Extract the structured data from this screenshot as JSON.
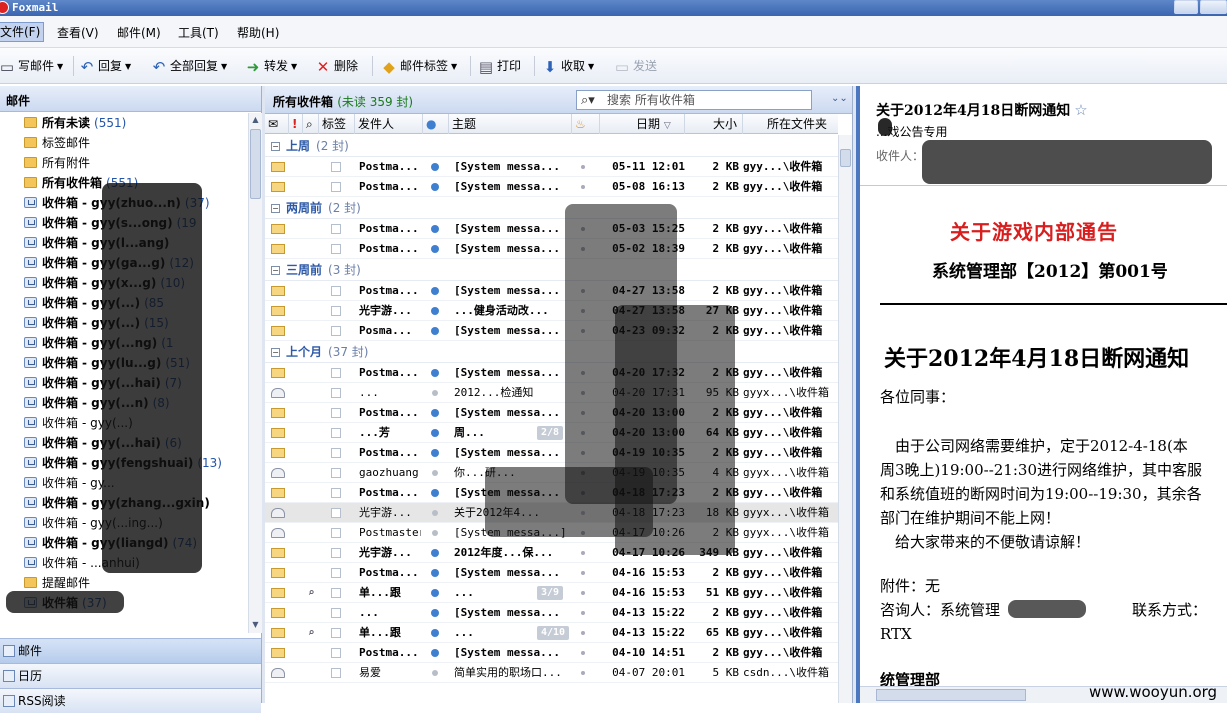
{
  "app": {
    "title": "Foxmail"
  },
  "menu": [
    "文件(F)",
    "查看(V)",
    "邮件(M)",
    "工具(T)",
    "帮助(H)"
  ],
  "toolbar": {
    "compose": "写邮件",
    "reply": "回复",
    "reply_all": "全部回复",
    "forward": "转发",
    "delete": "删除",
    "tag": "邮件标签",
    "print": "打印",
    "receive": "收取",
    "send": "发送"
  },
  "left": {
    "header": "邮件",
    "folders": [
      {
        "label": "所有未读",
        "count": "(551)",
        "bold": true,
        "type": "folder"
      },
      {
        "label": "标签邮件",
        "count": "",
        "bold": false,
        "type": "folder"
      },
      {
        "label": "所有附件",
        "count": "",
        "bold": false,
        "type": "folder"
      },
      {
        "label": "所有收件箱",
        "count": "(551)",
        "bold": true,
        "type": "folder"
      },
      {
        "label": "收件箱",
        "count": "(37)",
        "bold": true,
        "type": "inbox",
        "suffix": "- gyy(zhuo...n)"
      },
      {
        "label": "收件箱",
        "count": "(19",
        "bold": true,
        "type": "inbox",
        "suffix": "- gyy(s...ong)"
      },
      {
        "label": "收件箱",
        "count": "",
        "bold": true,
        "type": "inbox",
        "suffix": "- gyy(l...ang)"
      },
      {
        "label": "收件箱",
        "count": "(12)",
        "bold": true,
        "type": "inbox",
        "suffix": "- gyy(ga...g)"
      },
      {
        "label": "收件箱",
        "count": "(10)",
        "bold": true,
        "type": "inbox",
        "suffix": "- gyy(x...g)"
      },
      {
        "label": "收件箱",
        "count": "(85",
        "bold": true,
        "type": "inbox",
        "suffix": "- gyy(...)"
      },
      {
        "label": "收件箱",
        "count": "(15)",
        "bold": true,
        "type": "inbox",
        "suffix": "- gyy(...)"
      },
      {
        "label": "收件箱",
        "count": "(1",
        "bold": true,
        "type": "inbox",
        "suffix": "- gyy(...ng)"
      },
      {
        "label": "收件箱",
        "count": "(51)",
        "bold": true,
        "type": "inbox",
        "suffix": "- gyy(lu...g)"
      },
      {
        "label": "收件箱",
        "count": "(7)",
        "bold": true,
        "type": "inbox",
        "suffix": "- gyy(...hai)"
      },
      {
        "label": "收件箱",
        "count": "(8)",
        "bold": true,
        "type": "inbox",
        "suffix": "- gyy(...n)"
      },
      {
        "label": "收件箱",
        "count": "",
        "bold": false,
        "type": "inbox",
        "suffix": "- gyy(...)"
      },
      {
        "label": "收件箱",
        "count": "(6)",
        "bold": true,
        "type": "inbox",
        "suffix": "- gyy(...hai)"
      },
      {
        "label": "收件箱",
        "count": "(13)",
        "bold": true,
        "type": "inbox",
        "suffix": "- gyy(fengshuai)"
      },
      {
        "label": "收件箱",
        "count": "",
        "bold": false,
        "type": "inbox",
        "suffix": "- gy..."
      },
      {
        "label": "收件箱",
        "count": "",
        "bold": true,
        "type": "inbox",
        "suffix": "- gyy(zhang...gxin)"
      },
      {
        "label": "收件箱",
        "count": "",
        "bold": false,
        "type": "inbox",
        "suffix": "- gyy(...ing...)"
      },
      {
        "label": "收件箱",
        "count": "(74)",
        "bold": true,
        "type": "inbox",
        "suffix": "- gyy(liangd)"
      },
      {
        "label": "收件箱",
        "count": "",
        "bold": false,
        "type": "inbox",
        "suffix": "- ...anhui)"
      },
      {
        "label": "提醒邮件",
        "count": "",
        "bold": false,
        "type": "folder"
      },
      {
        "label": "收件箱",
        "count": "(37)",
        "bold": true,
        "type": "inbox",
        "suffix": ""
      }
    ],
    "nav": [
      "邮件",
      "日历",
      "RSS阅读"
    ]
  },
  "middle": {
    "title": "所有收件箱",
    "unread": "(未读 359 封)",
    "search_placeholder": "搜索 所有收件箱",
    "columns": {
      "tag": "标签",
      "sender": "发件人",
      "subject": "主题",
      "date": "日期",
      "size": "大小",
      "folder": "所在文件夹"
    },
    "groups": [
      {
        "name": "上周",
        "count": "(2 封)",
        "rows": [
          {
            "sender": "Postma...",
            "subject": "[System messa...",
            "date": "05-11 12:01",
            "size": "2 KB",
            "folder": "gyy...\\收件箱",
            "unread": true,
            "read_icon": false,
            "clip": false,
            "page": ""
          },
          {
            "sender": "Postma...",
            "subject": "[System messa...",
            "date": "05-08 16:13",
            "size": "2 KB",
            "folder": "gyy...\\收件箱",
            "unread": true,
            "read_icon": false,
            "clip": false,
            "page": ""
          }
        ]
      },
      {
        "name": "两周前",
        "count": "(2 封)",
        "rows": [
          {
            "sender": "Postma...",
            "subject": "[System messa...",
            "date": "05-03 15:25",
            "size": "2 KB",
            "folder": "gyy...\\收件箱",
            "unread": true,
            "read_icon": false,
            "clip": false,
            "page": ""
          },
          {
            "sender": "Postma...",
            "subject": "[System messa...",
            "date": "05-02 18:39",
            "size": "2 KB",
            "folder": "gyy...\\收件箱",
            "unread": true,
            "read_icon": false,
            "clip": false,
            "page": ""
          }
        ]
      },
      {
        "name": "三周前",
        "count": "(3 封)",
        "rows": [
          {
            "sender": "Postma...",
            "subject": "[System messa...",
            "date": "04-27 13:58",
            "size": "2 KB",
            "folder": "gyy...\\收件箱",
            "unread": true,
            "read_icon": false,
            "clip": false,
            "page": ""
          },
          {
            "sender": "光宇游...",
            "subject": "...健身活动改...",
            "date": "04-27 13:58",
            "size": "27 KB",
            "folder": "gyy...\\收件箱",
            "unread": true,
            "read_icon": false,
            "clip": false,
            "page": ""
          },
          {
            "sender": "Posma...",
            "subject": "[System messa...",
            "date": "04-23 09:32",
            "size": "2 KB",
            "folder": "gyy...\\收件箱",
            "unread": true,
            "read_icon": false,
            "clip": false,
            "page": ""
          }
        ]
      },
      {
        "name": "上个月",
        "count": "(37 封)",
        "rows": [
          {
            "sender": "Postma...",
            "subject": "[System messa...",
            "date": "04-20 17:32",
            "size": "2 KB",
            "folder": "gyy...\\收件箱",
            "unread": true,
            "read_icon": false,
            "clip": false,
            "page": ""
          },
          {
            "sender": "...",
            "subject": "2012...检通知",
            "date": "04-20 17:31",
            "size": "95 KB",
            "folder": "gyyx...\\收件箱",
            "unread": false,
            "read_icon": true,
            "clip": false,
            "page": ""
          },
          {
            "sender": "Postma...",
            "subject": "[System messa...",
            "date": "04-20 13:00",
            "size": "2 KB",
            "folder": "gyy...\\收件箱",
            "unread": true,
            "read_icon": false,
            "clip": false,
            "page": ""
          },
          {
            "sender": "...芳",
            "subject": "周...",
            "date": "04-20 13:00",
            "size": "64 KB",
            "folder": "gyy...\\收件箱",
            "unread": true,
            "read_icon": false,
            "clip": false,
            "page": "2/8"
          },
          {
            "sender": "Postma...",
            "subject": "[System messa...",
            "date": "04-19 10:35",
            "size": "2 KB",
            "folder": "gyy...\\收件箱",
            "unread": true,
            "read_icon": false,
            "clip": false,
            "page": ""
          },
          {
            "sender": "gaozhuang",
            "subject": "你...研...",
            "date": "04-19 10:35",
            "size": "4 KB",
            "folder": "gyyx...\\收件箱",
            "unread": false,
            "read_icon": true,
            "clip": false,
            "page": ""
          },
          {
            "sender": "Postma...",
            "subject": "[System messa...",
            "date": "04-18 17:23",
            "size": "2 KB",
            "folder": "gyy...\\收件箱",
            "unread": true,
            "read_icon": false,
            "clip": false,
            "page": ""
          },
          {
            "sender": "光宇游...",
            "subject": "关于2012年4...",
            "date": "04-18 17:23",
            "size": "18 KB",
            "folder": "gyyx...\\收件箱",
            "unread": false,
            "read_icon": true,
            "clip": false,
            "page": "",
            "selected": true
          },
          {
            "sender": "Postmaster",
            "subject": "[System messa...]...",
            "date": "04-17 10:26",
            "size": "2 KB",
            "folder": "gyyx...\\收件箱",
            "unread": false,
            "read_icon": true,
            "clip": false,
            "page": ""
          },
          {
            "sender": "光宇游...",
            "subject": "2012年度...保...",
            "date": "04-17 10:26",
            "size": "349 KB",
            "folder": "gyy...\\收件箱",
            "unread": true,
            "read_icon": false,
            "clip": false,
            "page": ""
          },
          {
            "sender": "Postma...",
            "subject": "[System messa...",
            "date": "04-16 15:53",
            "size": "2 KB",
            "folder": "gyy...\\收件箱",
            "unread": true,
            "read_icon": false,
            "clip": false,
            "page": ""
          },
          {
            "sender": "单...跟",
            "subject": "...",
            "date": "04-16 15:53",
            "size": "51 KB",
            "folder": "gyy...\\收件箱",
            "unread": true,
            "read_icon": false,
            "clip": true,
            "page": "3/9"
          },
          {
            "sender": "...",
            "subject": "[System messa...",
            "date": "04-13 15:22",
            "size": "2 KB",
            "folder": "gyy...\\收件箱",
            "unread": true,
            "read_icon": false,
            "clip": false,
            "page": ""
          },
          {
            "sender": "单...跟",
            "subject": "...",
            "date": "04-13 15:22",
            "size": "65 KB",
            "folder": "gyy...\\收件箱",
            "unread": true,
            "read_icon": false,
            "clip": true,
            "page": "4/10"
          },
          {
            "sender": "Postma...",
            "subject": "[System messa...",
            "date": "04-10 14:51",
            "size": "2 KB",
            "folder": "gyy...\\收件箱",
            "unread": true,
            "read_icon": false,
            "clip": false,
            "page": ""
          },
          {
            "sender": "易爱",
            "subject": "简单实用的职场口...",
            "date": "04-07 20:01",
            "size": "5 KB",
            "folder": "csdn...\\收件箱",
            "unread": false,
            "read_icon": true,
            "clip": false,
            "page": ""
          }
        ]
      }
    ]
  },
  "reader": {
    "subject": "关于2012年4月18日断网通知",
    "from": "...戏公告专用",
    "to_label": "收件人：",
    "body_heading": "关于游戏内部通告",
    "dept_line": "系统管理部【2012】第001号",
    "big_title": "关于2012年4月18日断网通知",
    "greeting": "各位同事：",
    "para1a": "　由于公司网络需要维护，定于2012-4-18(本",
    "para1b": "周3晚上)19:00--21:30进行网络维护，其中客服",
    "para1c": "和系统值班的断网时间为19:00--19:30，其余各",
    "para1d": "部门在维护期间不能上网！",
    "para2": "　给大家带来的不便敬请谅解！",
    "attach": "附件：无",
    "contact": "咨询人：系统管理",
    "contact_way": "联系方式：",
    "rtx": "RTX",
    "sign": "统管理部"
  },
  "watermark": "www.wooyun.org"
}
